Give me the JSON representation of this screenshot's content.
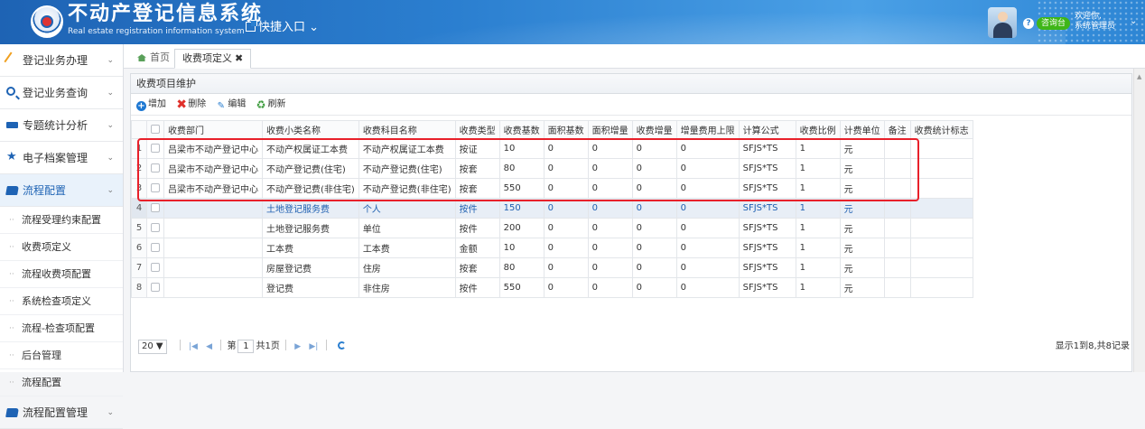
{
  "header": {
    "title": "不动产登记信息系统",
    "subtitle": "Real estate registration information system",
    "quick_entry": "快捷入口",
    "consult": "咨询台",
    "welcome": "欢迎你,",
    "user": "系统管理员"
  },
  "sidebar": {
    "items": [
      {
        "label": "登记业务办理",
        "icon": "pen-icon"
      },
      {
        "label": "登记业务查询",
        "icon": "search-icon"
      },
      {
        "label": "专题统计分析",
        "icon": "chart-icon"
      },
      {
        "label": "电子档案管理",
        "icon": "star-icon"
      },
      {
        "label": "流程配置",
        "icon": "folder-icon"
      }
    ],
    "sub_items": [
      "流程受理约束配置",
      "收费项定义",
      "流程收费项配置",
      "系统检查项定义",
      "流程-检查项配置",
      "后台管理",
      "流程配置"
    ],
    "bottom_item": {
      "label": "流程配置管理",
      "icon": "folder-icon"
    }
  },
  "tabs": {
    "home": "首页",
    "active": "收费项定义",
    "close": "✖"
  },
  "panel": {
    "title": "收费项目维护",
    "toolbar": {
      "add": "增加",
      "delete": "删除",
      "edit": "编辑",
      "refresh": "刷新"
    }
  },
  "table": {
    "columns": [
      "收费部门",
      "收费小类名称",
      "收费科目名称",
      "收费类型",
      "收费基数",
      "面积基数",
      "面积增量",
      "收费增量",
      "增量费用上限",
      "计算公式",
      "收费比例",
      "计费单位",
      "备注",
      "收费统计标志"
    ],
    "rows": [
      [
        "吕梁市不动产登记中心",
        "不动产权属证工本费",
        "不动产权属证工本费",
        "按证",
        "10",
        "0",
        "0",
        "0",
        "0",
        "SFJS*TS",
        "1",
        "元",
        "",
        ""
      ],
      [
        "吕梁市不动产登记中心",
        "不动产登记费(住宅)",
        "不动产登记费(住宅)",
        "按套",
        "80",
        "0",
        "0",
        "0",
        "0",
        "SFJS*TS",
        "1",
        "元",
        "",
        ""
      ],
      [
        "吕梁市不动产登记中心",
        "不动产登记费(非住宅)",
        "不动产登记费(非住宅)",
        "按套",
        "550",
        "0",
        "0",
        "0",
        "0",
        "SFJS*TS",
        "1",
        "元",
        "",
        ""
      ],
      [
        "",
        "土地登记服务费",
        "个人",
        "按件",
        "150",
        "0",
        "0",
        "0",
        "0",
        "SFJS*TS",
        "1",
        "元",
        "",
        ""
      ],
      [
        "",
        "土地登记服务费",
        "单位",
        "按件",
        "200",
        "0",
        "0",
        "0",
        "0",
        "SFJS*TS",
        "1",
        "元",
        "",
        ""
      ],
      [
        "",
        "工本费",
        "工本费",
        "金额",
        "10",
        "0",
        "0",
        "0",
        "0",
        "SFJS*TS",
        "1",
        "元",
        "",
        ""
      ],
      [
        "",
        "房屋登记费",
        "住房",
        "按套",
        "80",
        "0",
        "0",
        "0",
        "0",
        "SFJS*TS",
        "1",
        "元",
        "",
        ""
      ],
      [
        "",
        "登记费",
        "非住房",
        "按件",
        "550",
        "0",
        "0",
        "0",
        "0",
        "SFJS*TS",
        "1",
        "元",
        "",
        ""
      ]
    ],
    "row_numbers": [
      "1",
      "2",
      "3",
      "4",
      "5",
      "6",
      "7",
      "8"
    ],
    "selected_row": 4
  },
  "pager": {
    "page_size": "20",
    "page_prefix": "第",
    "current_page": "1",
    "page_suffix": "共1页",
    "info": "显示1到8,共8记录"
  }
}
